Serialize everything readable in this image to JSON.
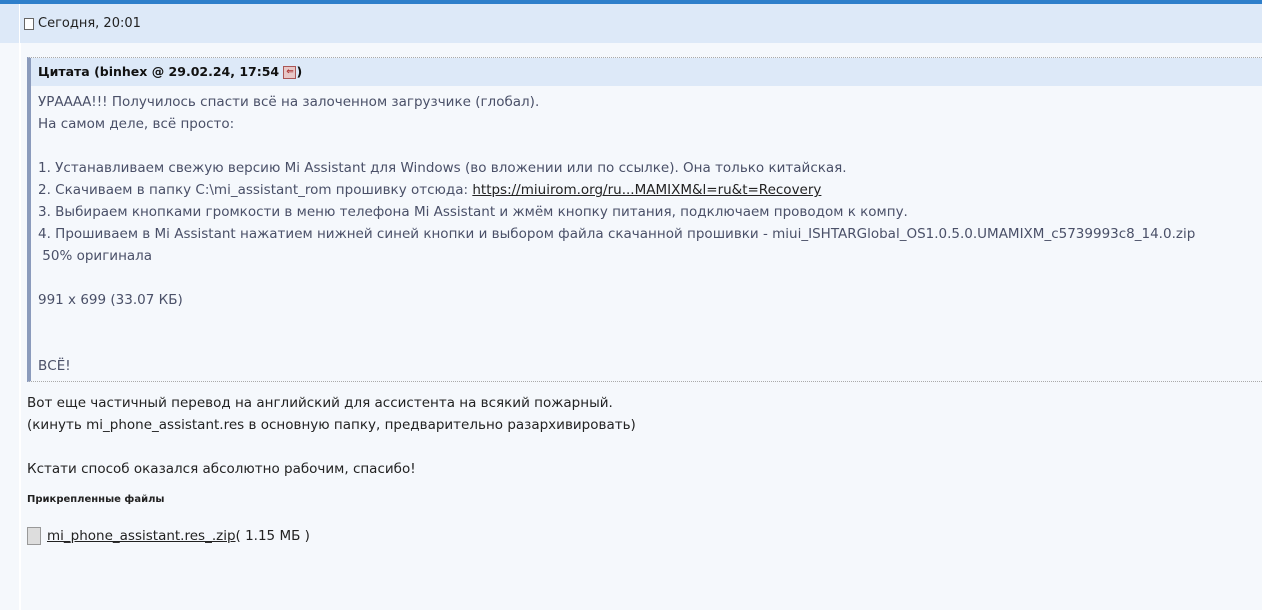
{
  "post": {
    "date": "Сегодня, 20:01"
  },
  "quote": {
    "header": "Цитата (binhex @ 29.02.24, 17:54 ",
    "header_close": ")",
    "lines": [
      "УРАААА!!! Получилось спасти всё на залоченном загрузчике (глобал).",
      "На самом деле, всё просто:",
      "",
      "1. Устанавливаем свежую версию Mi Assistant для Windows (во вложении или по ссылке). Она только китайская."
    ],
    "line2_prefix": "2. Скачиваем в папку C:\\mi_assistant_rom прошивку отсюда: ",
    "link": "https://miuirom.org/ru...MAMIXM&l=ru&t=Recovery",
    "lines2": [
      "3. Выбираем кнопками громкости в меню телефона Mi Assistant и жмём кнопку питания, подключаем проводом к компу.",
      "4. Прошиваем в Mi Assistant нажатием нижней синей кнопки и выбором файла скачанной прошивки - miui_ISHTARGlobal_OS1.0.5.0.UMAMIXM_c5739993c8_14.0.zip",
      " 50% оригинала",
      "",
      "991 x 699 (33.07 КБ)",
      "",
      "",
      "ВСЁ!"
    ]
  },
  "body": [
    "Вот еще частичный перевод на английский для ассистента на всякий пожарный.",
    "(кинуть mi_phone_assistant.res в основную папку, предварительно разархивировать)",
    "",
    "Кстати способ оказался абсолютно рабочим, спасибо!"
  ],
  "attachments": {
    "title": "Прикрепленные файлы",
    "file": "mi_phone_assistant.res_.zip",
    "size": " ( 1.15 МБ )"
  }
}
